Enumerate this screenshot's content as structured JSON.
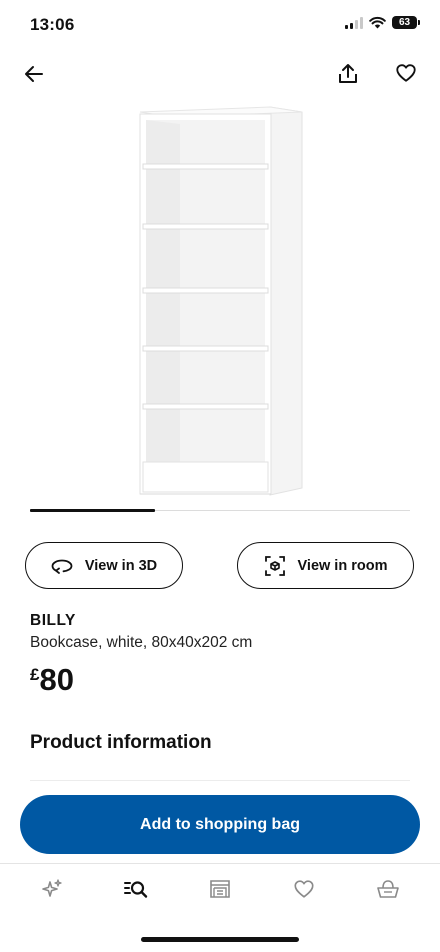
{
  "status_bar": {
    "time": "13:06",
    "battery_level": "63"
  },
  "top_nav": {
    "back_icon": "arrow-left-icon",
    "share_icon": "share-icon",
    "favourite_icon": "heart-icon"
  },
  "product": {
    "image_icon": "bookcase-image",
    "carousel_progress": 0.33,
    "view_3d_label": "View in 3D",
    "view_room_label": "View in room",
    "name": "BILLY",
    "description": "Bookcase, white, 80x40x202 cm",
    "price_currency": "£",
    "price_value": "80"
  },
  "sections": {
    "product_information": "Product information"
  },
  "cta": {
    "add_to_bag_label": "Add to shopping bag",
    "color": "#0058a3"
  },
  "tab_bar": {
    "items": [
      {
        "icon": "sparkle-icon"
      },
      {
        "icon": "search-list-icon",
        "active": true
      },
      {
        "icon": "store-icon"
      },
      {
        "icon": "heart-icon"
      },
      {
        "icon": "basket-icon"
      }
    ]
  }
}
